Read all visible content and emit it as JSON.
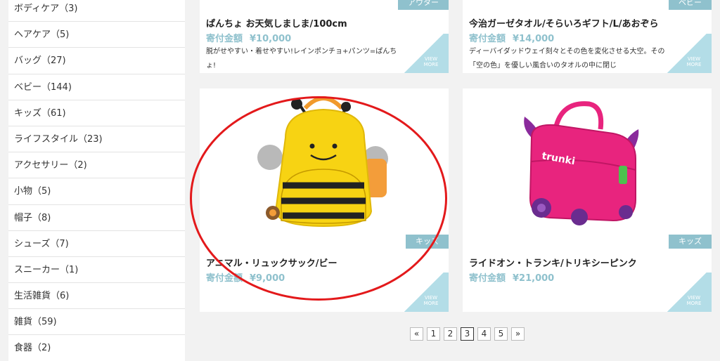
{
  "sidebar": {
    "categories": [
      "ボディケア（3)",
      "ヘアケア（5)",
      "バッグ（27)",
      "ベビー（144)",
      "キッズ（61)",
      "ライフスタイル（23)",
      "アクセサリー（2)",
      "小物（5)",
      "帽子（8)",
      "シューズ（7)",
      "スニーカー（1)",
      "生活雑貨（6)",
      "雑貨（59)",
      "食器（2)"
    ]
  },
  "products": [
    {
      "tag": "アウター",
      "title": "ぱんちょ お天気しましま/100cm",
      "price_label": "寄付金額",
      "price": "¥10,000",
      "desc": "脱がせやすい・着せやすい!レインポンチョ+パンツ=ぱんちょ!",
      "more": "VIEW MORE"
    },
    {
      "tag": "ベビー",
      "title": "今治ガーゼタオル/そらいろギフト/L/あおぞら",
      "price_label": "寄付金額",
      "price": "¥14,000",
      "desc": "ディーバイダッドウェイ刻々とその色を変化させる大空。その「空の色」を優しい風合いのタオルの中に閉じ",
      "more": "VIEW MORE"
    },
    {
      "tag": "キッズ",
      "title": "アニマル・リュックサック/ビー",
      "price_label": "寄付金額",
      "price": "¥9,000",
      "more": "VIEW MORE"
    },
    {
      "tag": "キッズ",
      "title": "ライドオン・トランキ/トリキシーピンク",
      "price_label": "寄付金額",
      "price": "¥21,000",
      "more": "VIEW MORE",
      "logo_text": "trunki"
    }
  ],
  "pagination": {
    "prev": "«",
    "pages": [
      "1",
      "2",
      "3",
      "4",
      "5"
    ],
    "current": "3",
    "next": "»"
  },
  "colors": {
    "accent": "#8fc1cd",
    "annotation": "#e3191b",
    "bee_yellow": "#f7d313",
    "trunki_pink": "#e8247e"
  }
}
